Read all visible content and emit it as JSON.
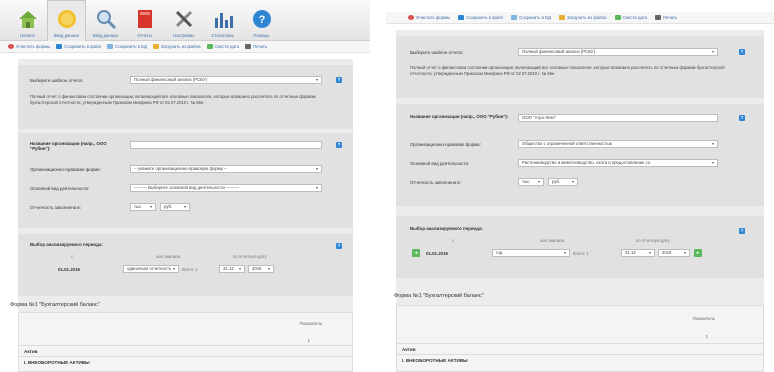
{
  "ribbon": {
    "tabs": [
      {
        "label": "Начало"
      },
      {
        "label": "Ввод данных"
      },
      {
        "label": "Ввод данных"
      },
      {
        "label": "Отчеты"
      },
      {
        "label": "Настройки"
      },
      {
        "label": "Статистика"
      },
      {
        "label": "Помощь"
      }
    ]
  },
  "toolbar": {
    "items": [
      {
        "label": "Очистить формы",
        "color": "#d9534f"
      },
      {
        "label": "Сохранить в файл",
        "color": "#2f86d4"
      },
      {
        "label": "Сохранить в БД",
        "color": "#2f86d4"
      },
      {
        "label": "Загрузить из файла",
        "color": "#e8b030"
      },
      {
        "label": "Свести дата",
        "color": "#5cb85c"
      },
      {
        "label": "Печать",
        "color": "#666666"
      }
    ]
  },
  "template": {
    "label": "Выберите шаблон отчета:",
    "value": "Полный финансовый анализ (РСБУ)",
    "description": "Полный отчет о финансовом состоянии организации, включающий все основные показатели, которые возможно рассчитать по отчетным формам бухгалтерской отчетности, утвержденным Приказом Минфина РФ от 02.07.2010 г. № 66н."
  },
  "org": {
    "name_label": "Название организации (напр., ООО \"Рубин\"):",
    "legal_form_label": "Организационно-правовая форма:",
    "activity_label": "Основной вид деятельности:",
    "units_label": "Отчетность заполнена в:",
    "left": {
      "name_value": "",
      "legal_form_value": "-- укажите организационно-правовую форму --",
      "activity_value": "--------- Выберите основной вид деятельности ---------",
      "units_1": "тыс.",
      "units_2": "руб."
    },
    "right": {
      "name_value": "ООО \"Агро-Лекс\"",
      "legal_form_value": "Общество с ограниченной ответственностью",
      "activity_value": "Растениеводство и животноводство, охота и предоставление со",
      "units_1": "тыс.",
      "units_2": "руб."
    }
  },
  "period": {
    "title": "Выбор анализируемого периода:",
    "col_start": "с",
    "col_step": "шаг анализа",
    "col_end": "по отчетную дату",
    "left": {
      "date": "01.01.2016",
      "step": "одиночная отчетность",
      "step_extra": "Всего: 1",
      "day": "31.12",
      "year": "2016"
    },
    "right": {
      "date": "01.01.2016",
      "step": "год",
      "step_extra": "Всего: 1",
      "day": "31.12",
      "year": "2016"
    }
  },
  "form": {
    "title": "Форма №1 \"Бухгалтерский баланс\"",
    "col_indicator": "Показатель",
    "col_num": "1",
    "section": "Актив",
    "subsection": "I. ВНЕОБОРОТНЫЕ АКТИВЫ"
  }
}
